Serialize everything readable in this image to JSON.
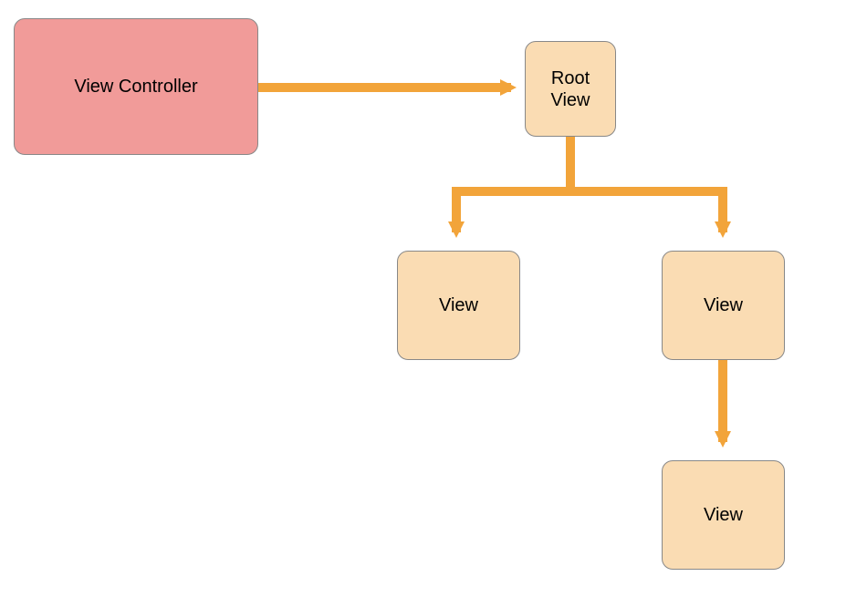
{
  "nodes": {
    "controller": {
      "label": "View Controller"
    },
    "root": {
      "label_line1": "Root",
      "label_line2": "View"
    },
    "view_left": {
      "label": "View"
    },
    "view_right": {
      "label": "View"
    },
    "view_bottom": {
      "label": "View"
    }
  },
  "colors": {
    "controller_fill": "#f19b99",
    "view_fill": "#fadcb3",
    "border": "#888888",
    "arrow": "#f2a43a"
  },
  "diagram": {
    "type": "hierarchy",
    "description": "View Controller owns Root View; Root View has two child Views; right child View has one grandchild View."
  }
}
